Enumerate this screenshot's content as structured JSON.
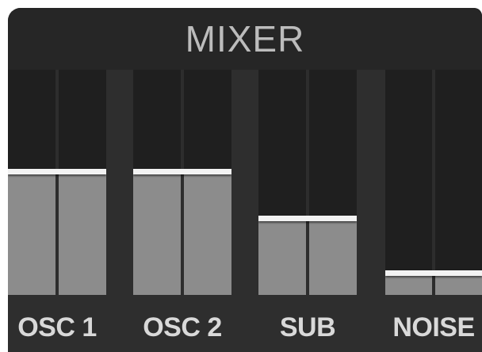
{
  "mixer": {
    "title": "MIXER",
    "channels": [
      {
        "label": "OSC 1",
        "level": 0.55
      },
      {
        "label": "OSC 2",
        "level": 0.55
      },
      {
        "label": "SUB",
        "level": 0.34
      },
      {
        "label": "NOISE",
        "level": 0.1
      }
    ]
  }
}
